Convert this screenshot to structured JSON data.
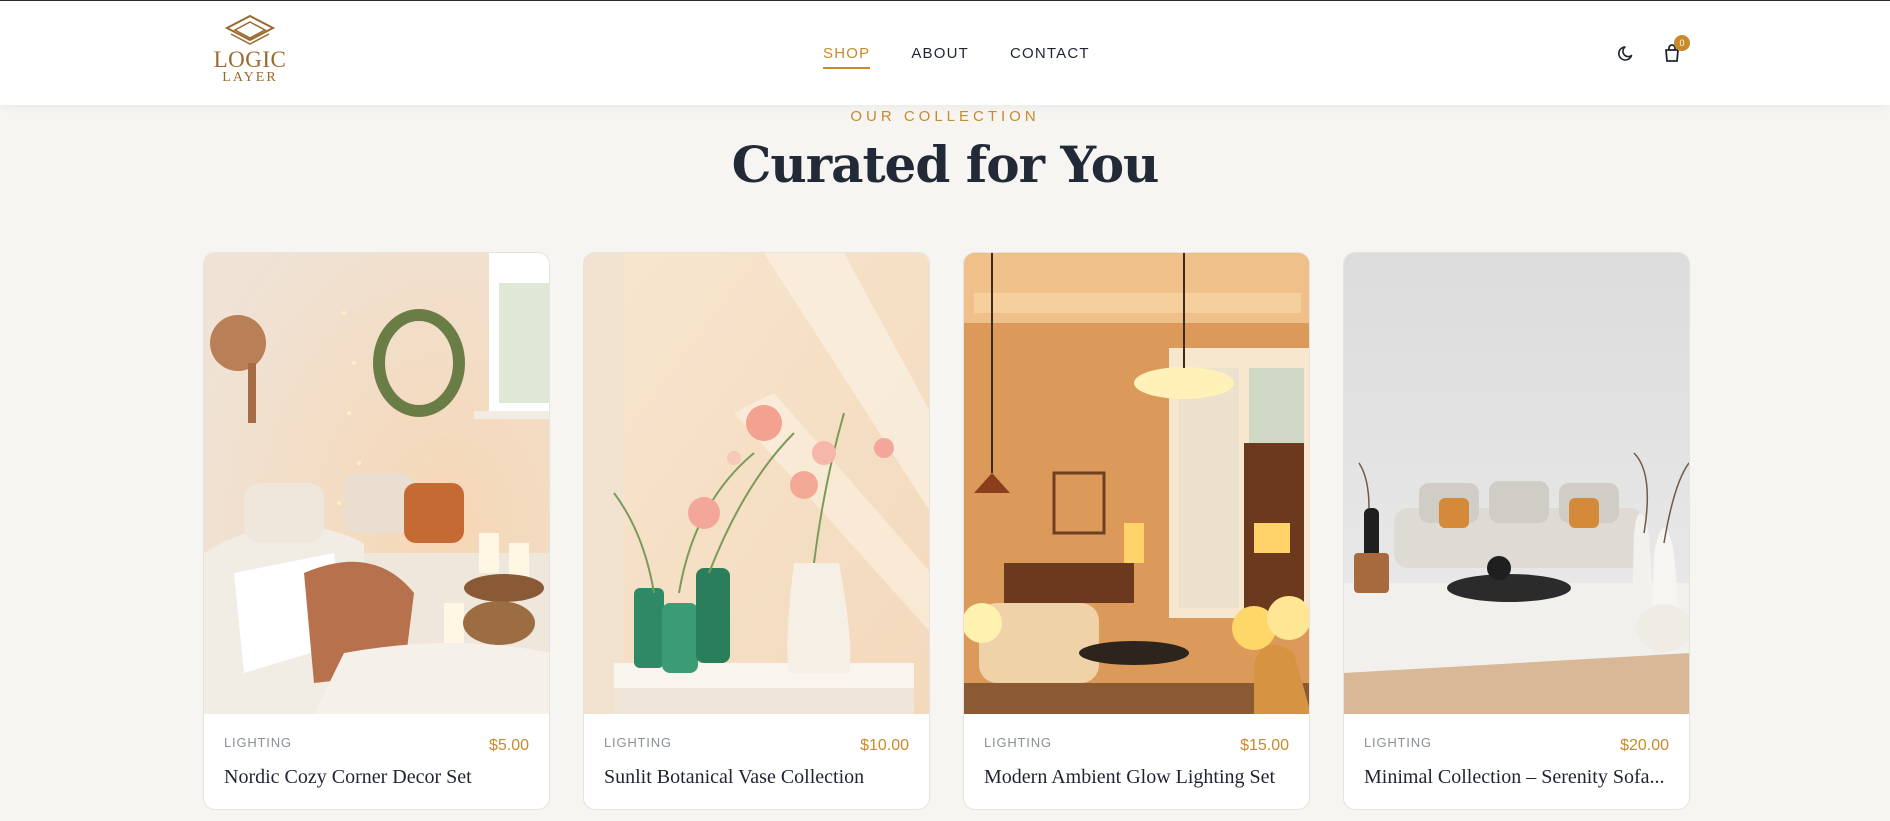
{
  "brand": {
    "line1": "LOGIC",
    "line2": "LAYER"
  },
  "nav": {
    "items": [
      {
        "label": "SHOP",
        "active": true
      },
      {
        "label": "ABOUT",
        "active": false
      },
      {
        "label": "CONTACT",
        "active": false
      }
    ]
  },
  "header_actions": {
    "theme_icon": "moon-icon",
    "cart_icon": "bag-icon",
    "cart_count": "0"
  },
  "section": {
    "eyebrow": "OUR COLLECTION",
    "title": "Curated for You"
  },
  "products": [
    {
      "category": "LIGHTING",
      "price": "$5.00",
      "title": "Nordic Cozy Corner Decor Set"
    },
    {
      "category": "LIGHTING",
      "price": "$10.00",
      "title": "Sunlit Botanical Vase Collection"
    },
    {
      "category": "LIGHTING",
      "price": "$15.00",
      "title": "Modern Ambient Glow Lighting Set"
    },
    {
      "category": "LIGHTING",
      "price": "$20.00",
      "title": "Minimal Collection – Serenity Sofa..."
    }
  ],
  "colors": {
    "accent": "#c98a2a",
    "text": "#1f2430",
    "background": "#f6f5f1"
  }
}
